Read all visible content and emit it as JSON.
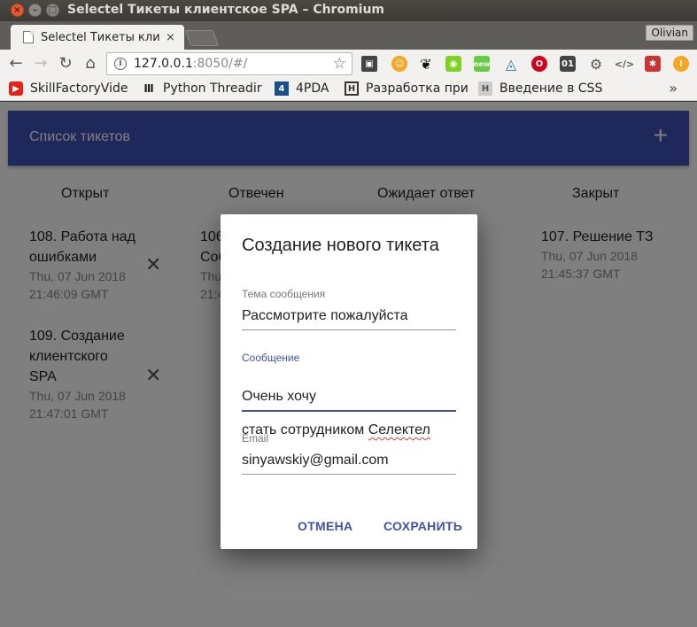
{
  "window": {
    "title": "Selectel Тикеты клиентское SPA – Chromium",
    "profile": "Olivian"
  },
  "tab": {
    "title": "Selectel Тикеты кли",
    "close": "×"
  },
  "toolbar": {
    "url_host": "127.0.0.1",
    "url_port": ":8050",
    "url_path": "/#/",
    "extension_new_badge": "new",
    "extension_01_label": "01"
  },
  "bookmarks": [
    {
      "label": "SkillFactoryVide",
      "icon": "youtube-icon"
    },
    {
      "label": "Python Threadir",
      "icon": "bookmark-icon"
    },
    {
      "label": "4PDA",
      "icon": "4pda-icon"
    },
    {
      "label": "Разработка при",
      "icon": "habr-icon"
    },
    {
      "label": "Введение в CSS",
      "icon": "htmlacademy-icon"
    }
  ],
  "app": {
    "header_title": "Список тикетов",
    "add_symbol": "+",
    "columns": [
      "Открыт",
      "Отвечен",
      "Ожидает ответ",
      "Закрыт"
    ],
    "tickets_open": [
      {
        "title": "108. Работа над ошибками",
        "date": "Thu, 07 Jun 2018",
        "time": "21:46:09 GMT"
      },
      {
        "title": "109. Создание клиентского SPA",
        "date": "Thu, 07 Jun 2018",
        "time": "21:47:01 GMT"
      }
    ],
    "tickets_answered_partial": {
      "title_start": "106",
      "title_line2": "Соб",
      "date_start": "Thu",
      "time_start": "21:4"
    },
    "tickets_closed": [
      {
        "title": "107. Решение ТЗ",
        "date": "Thu, 07 Jun 2018",
        "time": "21:45:37 GMT"
      }
    ],
    "delete_symbol": "✕"
  },
  "dialog": {
    "title": "Создание нового тикета",
    "subject_label": "Тема сообщения",
    "subject_value": "Рассмотрите пожалуйста",
    "message_label": "Сообщение",
    "message_line1": "Очень хочу",
    "message_line2_start": "стать сотрудником ",
    "message_line2_word": "Селектел",
    "email_label": "Email",
    "email_value": "sinyawskiy@gmail.com",
    "cancel_label": "ОТМЕНА",
    "save_label": "СОХРАНИТЬ"
  },
  "colors": {
    "primary": "#3f51b5",
    "overlay": "rgba(0,0,0,0.5)",
    "close_button": "#e6592e"
  }
}
